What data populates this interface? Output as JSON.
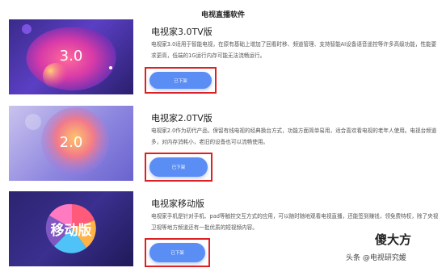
{
  "page": {
    "title": "电视直播软件"
  },
  "products": [
    {
      "badge": "3.0",
      "name": "电视家3.0TV版",
      "description": "电视家3.0适用于智能电视，在原有基础上增加了回看时移、频道管理、支持智能AI设备语音遥控等许多高级功能，性能要求更高，低端的1G运行内存可能无法流畅运行。",
      "button_label": "已下架"
    },
    {
      "badge": "2.0",
      "name": "电视家2.0TV版",
      "description": "电视家2.0作为初代产品，保留有线电视的经典换台方式，功能方面简单易用，适合喜欢看电视的老年人使用。电视台频道多，对内存消耗小，老旧的设备也可以流畅使用。",
      "button_label": "已下架"
    },
    {
      "badge": "移动版",
      "name": "电视家移动版",
      "description": "电视家手机是针对手机、pad等触控交互方式的应用，可以随时随地观看电视直播，还能签到赚钱，领免费特权，除了央视卫视等地方频道还有一批优质的短视频内容。",
      "button_label": "已下架"
    }
  ],
  "watermark": {
    "brand": "傻大方",
    "source": "头条 @电视研究媛"
  },
  "colors": {
    "button": "#5a8ef5",
    "highlight_frame": "#e02020"
  }
}
